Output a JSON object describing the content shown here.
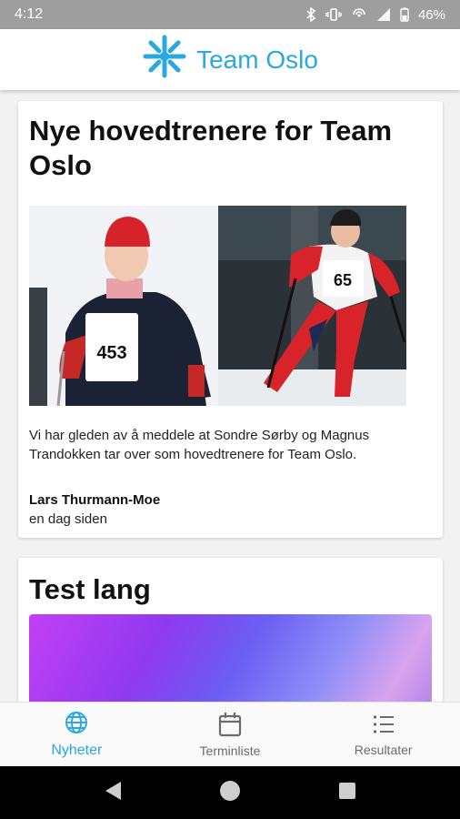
{
  "status_bar": {
    "time": "4:12",
    "battery": "46%"
  },
  "app_bar": {
    "title": "Team Oslo"
  },
  "articles": [
    {
      "title": "Nye hovedtrenere for Team Oslo",
      "left_bib": "453",
      "right_bib": "65",
      "excerpt": "Vi har gleden av å meddele at Sondre Sørby og Magnus Trandokken tar over som hovedtrenere for Team Oslo.",
      "author": "Lars Thurmann-Moe",
      "date": "en dag siden"
    },
    {
      "title": "Test lang"
    }
  ],
  "bottom_nav": {
    "items": [
      {
        "label": "Nyheter",
        "icon": "globe-icon",
        "active": true
      },
      {
        "label": "Terminliste",
        "icon": "calendar-icon",
        "active": false
      },
      {
        "label": "Resultater",
        "icon": "list-icon",
        "active": false
      }
    ]
  },
  "colors": {
    "accent": "#29a9e0"
  }
}
